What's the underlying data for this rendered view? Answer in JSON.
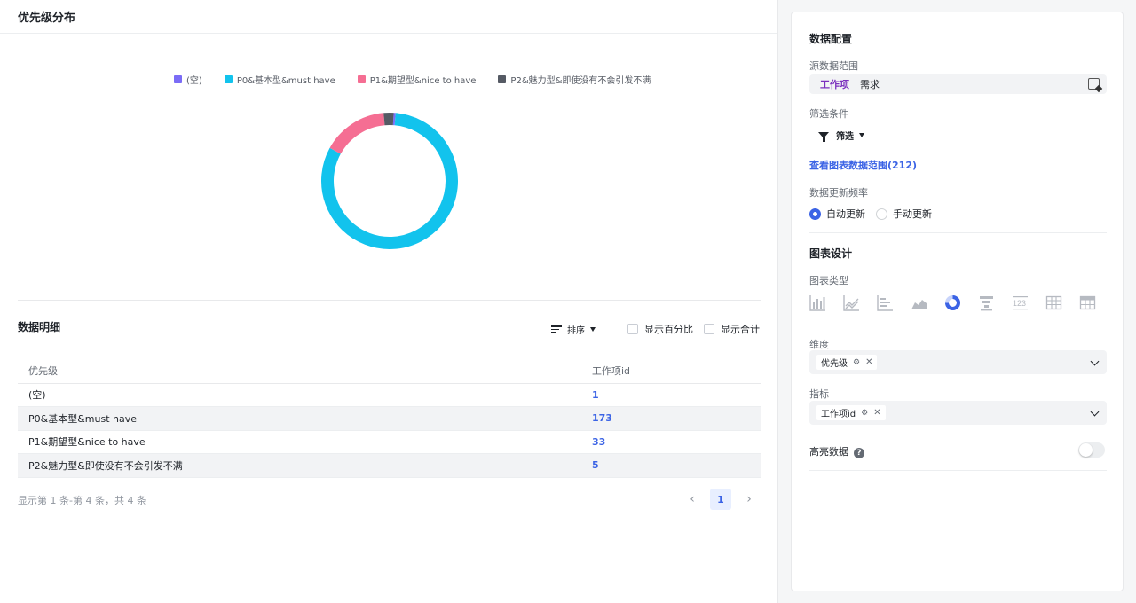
{
  "header": {
    "title": "优先级分布"
  },
  "colors": {
    "empty": "#7b6cf6",
    "p0": "#12c3ed",
    "p1": "#f56e93",
    "p2": "#555a64",
    "accent": "#3b63e5",
    "tag": "#7b2fbe"
  },
  "chart_data": {
    "type": "pie",
    "labels": [
      "(空)",
      "P0&基本型&must have",
      "P1&期望型&nice to have",
      "P2&魅力型&即使没有不会引发不满"
    ],
    "values": [
      1,
      173,
      33,
      5
    ],
    "colors": [
      "#7b6cf6",
      "#12c3ed",
      "#f56e93",
      "#555a64"
    ],
    "donut": true,
    "legend_position": "top"
  },
  "detail": {
    "title": "数据明细",
    "sort_label": "排序",
    "show_percent": "显示百分比",
    "show_total": "显示合计",
    "columns": [
      "优先级",
      "工作项id"
    ],
    "rows": [
      {
        "name": "(空)",
        "value": "1"
      },
      {
        "name": "P0&基本型&must have",
        "value": "173"
      },
      {
        "name": "P1&期望型&nice to have",
        "value": "33"
      },
      {
        "name": "P2&魅力型&即使没有不会引发不满",
        "value": "5"
      }
    ],
    "pager_info": "显示第 1 条-第 4 条，共 4 条",
    "current_page": "1"
  },
  "config": {
    "title": "数据配置",
    "source_label": "源数据范围",
    "source_tag": "工作项",
    "source_value": "需求",
    "filter_label": "筛选条件",
    "filter_btn": "筛选",
    "view_range_link": "查看图表数据范围(212)",
    "update_label": "数据更新频率",
    "auto_update": "自动更新",
    "manual_update": "手动更新"
  },
  "design": {
    "title": "图表设计",
    "chart_type_label": "图表类型",
    "chart_types": [
      "bar-chart-icon",
      "line-chart-icon",
      "horizontal-bar-icon",
      "area-chart-icon",
      "donut-chart-icon",
      "funnel-chart-icon",
      "number-card-icon",
      "table-icon",
      "pivot-table-icon"
    ],
    "dimension_label": "维度",
    "dimension_value": "优先级",
    "metric_label": "指标",
    "metric_value": "工作项id",
    "highlight_label": "高亮数据",
    "help": "?"
  }
}
